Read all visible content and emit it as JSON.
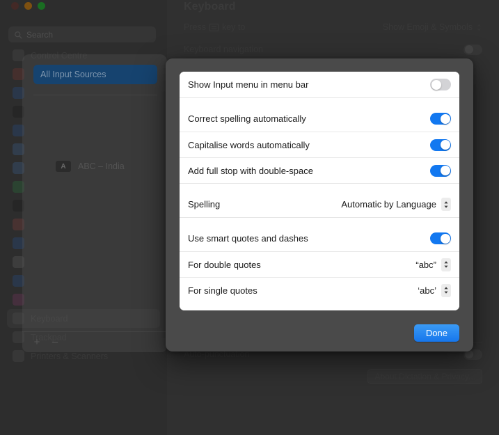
{
  "window": {
    "traffic_lights": [
      "close",
      "minimize",
      "zoom"
    ],
    "search_placeholder": "Search"
  },
  "sidebar": {
    "items": [
      {
        "label": "Control Centre",
        "color": "#6e6e6e"
      },
      {
        "label": "",
        "color": "#b5453b"
      },
      {
        "label": "",
        "color": "#2f6fd0"
      },
      {
        "label": "",
        "color": "#1c1c1c"
      },
      {
        "label": "",
        "color": "#2f6fd0"
      },
      {
        "label": "",
        "color": "#4f8fd8"
      },
      {
        "label": "",
        "color": "#4f8fd8"
      },
      {
        "label": "",
        "color": "#35a853"
      },
      {
        "label": "",
        "color": "#1c1c1c"
      },
      {
        "label": "",
        "color": "#c2554f"
      },
      {
        "label": "",
        "color": "#2f6fd0"
      },
      {
        "label": "",
        "color": "#8a8a8a"
      },
      {
        "label": "",
        "color": "#2f6fd0"
      },
      {
        "label": "",
        "color": "#b54a8a"
      },
      {
        "label": "Keyboard",
        "color": "#6e6e6e",
        "selected": true
      },
      {
        "label": "Trackpad",
        "color": "#6e6e6e"
      },
      {
        "label": "Printers & Scanners",
        "color": "#6e6e6e"
      }
    ]
  },
  "detail": {
    "title": "Keyboard",
    "rows": [
      {
        "label": "Press",
        "label_suffix": "key to",
        "value": "Show Emoji & Symbols",
        "control": "popup"
      },
      {
        "label": "Keyboard navigation",
        "value": "",
        "control": "toggle"
      }
    ],
    "bottom_rows": [
      {
        "label": "Auto-punctuation",
        "value": "",
        "control": "toggle"
      }
    ],
    "about_button": "About Dictation & Privacy..."
  },
  "input_sources_sheet": {
    "all_sources_label": "All Input Sources",
    "source_badge": "A",
    "source_label": "ABC – India",
    "add_button": "+",
    "remove_button": "–"
  },
  "modal": {
    "groups": [
      {
        "rows": [
          {
            "label": "Show Input menu in menu bar",
            "control": "toggle",
            "state": "off"
          }
        ]
      },
      {
        "rows": [
          {
            "label": "Correct spelling automatically",
            "control": "toggle",
            "state": "on"
          },
          {
            "label": "Capitalise words automatically",
            "control": "toggle",
            "state": "on"
          },
          {
            "label": "Add full stop with double-space",
            "control": "toggle",
            "state": "on"
          }
        ]
      },
      {
        "rows": [
          {
            "label": "Spelling",
            "control": "popup",
            "value": "Automatic by Language"
          }
        ]
      },
      {
        "rows": [
          {
            "label": "Use smart quotes and dashes",
            "control": "toggle",
            "state": "on"
          },
          {
            "label": "For double quotes",
            "control": "popup",
            "value": "“abc”"
          },
          {
            "label": "For single quotes",
            "control": "popup",
            "value": "‘abc’"
          }
        ]
      }
    ],
    "done_label": "Done"
  },
  "colors": {
    "accent": "#1278f0",
    "done_button": "#2b8cf0",
    "selection": "#16436f"
  }
}
